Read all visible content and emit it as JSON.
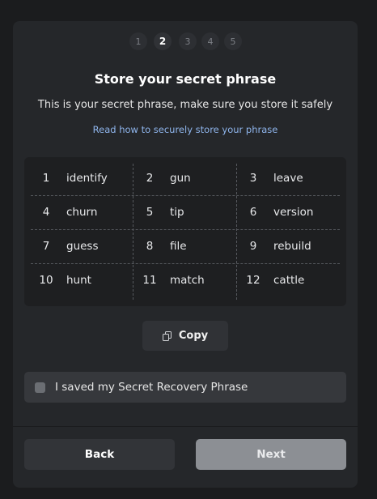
{
  "stepper": {
    "steps": [
      "1",
      "2",
      "3",
      "4",
      "5"
    ],
    "active_index": 1
  },
  "title": "Store your secret phrase",
  "subtitle": "This is your secret phrase, make sure you store it safely",
  "help_link": "Read how to securely store your phrase",
  "phrase": [
    {
      "num": "1",
      "word": "identify"
    },
    {
      "num": "2",
      "word": "gun"
    },
    {
      "num": "3",
      "word": "leave"
    },
    {
      "num": "4",
      "word": "churn"
    },
    {
      "num": "5",
      "word": "tip"
    },
    {
      "num": "6",
      "word": "version"
    },
    {
      "num": "7",
      "word": "guess"
    },
    {
      "num": "8",
      "word": "file"
    },
    {
      "num": "9",
      "word": "rebuild"
    },
    {
      "num": "10",
      "word": "hunt"
    },
    {
      "num": "11",
      "word": "match"
    },
    {
      "num": "12",
      "word": "cattle"
    }
  ],
  "copy_button": {
    "label": "Copy",
    "icon": "copy-icon"
  },
  "confirm_checkbox": {
    "label": "I saved my Secret Recovery Phrase",
    "checked": false
  },
  "buttons": {
    "back": "Back",
    "next": "Next"
  },
  "colors": {
    "background": "#1b1c1e",
    "card": "#25272a",
    "link": "#8fb5ec",
    "next_disabled": "#8c8f94"
  }
}
